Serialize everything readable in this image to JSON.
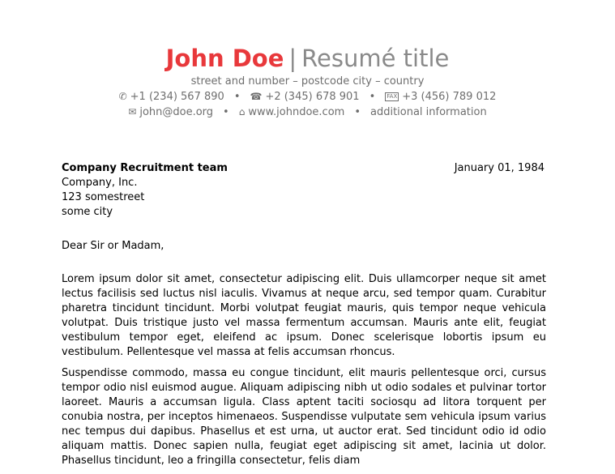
{
  "header": {
    "first_name": "John",
    "last_name": "Doe",
    "name": "John Doe",
    "separator": "|",
    "title": "Resumé title",
    "address": "street and number – postcode city – country",
    "mobile": "+1 (234) 567 890",
    "phone": "+2 (345) 678 901",
    "fax": "+3 (456) 789 012",
    "email": "john@doe.org",
    "homepage": "www.johndoe.com",
    "extra": "additional information",
    "bullet": "•",
    "icons": {
      "mobile": "mobile-phone-icon",
      "phone": "telephone-icon",
      "fax": "fax-icon",
      "email": "envelope-icon",
      "homepage": "home-link-icon"
    },
    "fax_icon_text": "FAX",
    "name_color": "#e8383b",
    "subtitle_color": "#8a8a8a"
  },
  "recipient": {
    "name": "Company Recruitment team",
    "company": "Company, Inc.",
    "street": "123 somestreet",
    "city": "some city"
  },
  "date": "January 01, 1984",
  "salutation": "Dear Sir or Madam,",
  "paragraphs": [
    "Lorem ipsum dolor sit amet, consectetur adipiscing elit. Duis ullamcorper neque sit amet lectus facilisis sed luctus nisl iaculis. Vivamus at neque arcu, sed tempor quam. Curabitur pharetra tincidunt tincidunt. Morbi volutpat feugiat mauris, quis tempor neque vehicula volutpat. Duis tristique justo vel massa fermentum accumsan. Mauris ante elit, feugiat vestibulum tempor eget, eleifend ac ipsum. Donec scelerisque lobortis ipsum eu vestibulum. Pellentesque vel massa at felis accumsan rhoncus.",
    "Suspendisse commodo, massa eu congue tincidunt, elit mauris pellentesque orci, cursus tempor odio nisl euismod augue. Aliquam adipiscing nibh ut odio sodales et pulvinar tortor laoreet. Mauris a accumsan ligula. Class aptent taciti sociosqu ad litora torquent per conubia nostra, per inceptos himenaeos. Suspendisse vulputate sem vehicula ipsum varius nec tempus dui dapibus. Phasellus et est urna, ut auctor erat. Sed tincidunt odio id odio aliquam mattis. Donec sapien nulla, feugiat eget adipiscing sit amet, lacinia ut dolor. Phasellus tincidunt, leo a fringilla consectetur, felis diam"
  ]
}
